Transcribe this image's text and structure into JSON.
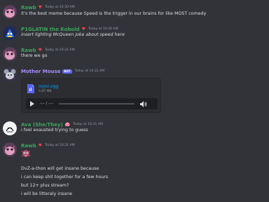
{
  "messages": [
    {
      "author": "Rawb",
      "author_color": "#3ba55c",
      "role_icon": "♥",
      "timestamp": "Today at 10:30 AM",
      "lines": [
        "it's the best meme because Speed is the trigger in our brains for like MOST comedy"
      ]
    },
    {
      "author": "P1GLATIN the Kobold",
      "author_color": "#3ba55c",
      "role_icon": "♥",
      "timestamp": "Today at 10:30 AM",
      "lines": [
        "insert lighting McQueen joke about speed here"
      ]
    },
    {
      "author": "Rawb",
      "author_color": "#3ba55c",
      "role_icon": "♥",
      "timestamp": "Today at 10:31 AM",
      "lines": [
        "there we go"
      ]
    },
    {
      "author": "Mother Mouse",
      "author_color": "#a78bfa",
      "bot_tag": "BOT",
      "timestamp": "Today at 10:31 AM",
      "attachment": {
        "filename": "mjml.ogg",
        "size": "5.87 MB",
        "time_display": "-:-- / -:--"
      }
    },
    {
      "author": "Ava (She/They)",
      "author_color": "#3ba55c",
      "role_icon": "🐽",
      "timestamp": "Today at 10:31 AM",
      "lines": [
        "i feel exausted trying to guess"
      ]
    },
    {
      "author": "Rawb",
      "author_color": "#3ba55c",
      "role_icon": "♥",
      "timestamp": "Today at 10:31 AM",
      "lines": [
        "DvZ-a-thon will get insane because",
        "i can keep shit together for a few hours",
        "but 12+ plus stream?",
        "i will be litteraly insane"
      ]
    }
  ]
}
